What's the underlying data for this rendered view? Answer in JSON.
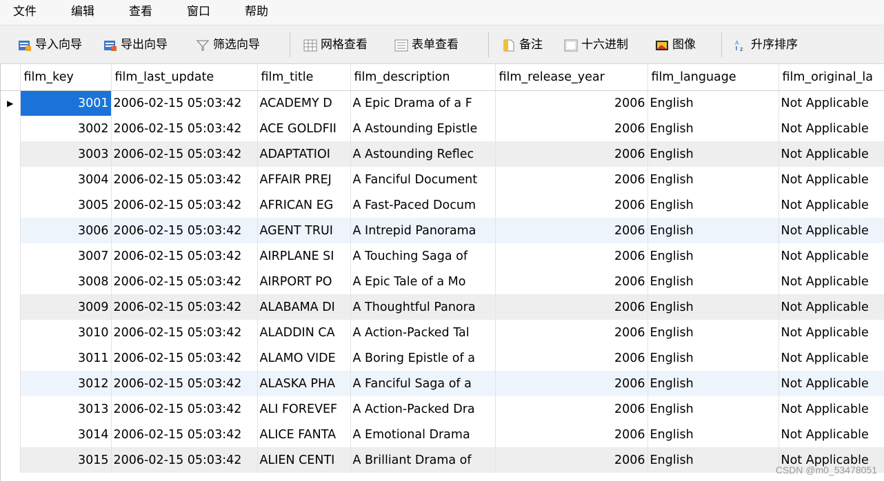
{
  "menu": [
    "文件",
    "编辑",
    "查看",
    "窗口",
    "帮助"
  ],
  "toolbar": {
    "import_label": "导入向导",
    "export_label": "导出向导",
    "filter_label": "筛选向导",
    "grid_view_label": "网格查看",
    "form_view_label": "表单查看",
    "memo_label": "备注",
    "hex_label": "十六进制",
    "image_label": "图像",
    "sort_asc_label": "升序排序"
  },
  "grid": {
    "columns": [
      "film_key",
      "film_last_update",
      "film_title",
      "film_description",
      "film_release_year",
      "film_language",
      "film_original_la"
    ],
    "rows": [
      [
        "3001",
        "2006-02-15 05:03:42",
        "ACADEMY D",
        "A Epic Drama of a F",
        "2006",
        "English",
        "Not Applicable"
      ],
      [
        "3002",
        "2006-02-15 05:03:42",
        "ACE GOLDFII",
        "A Astounding Epistle",
        "2006",
        "English",
        "Not Applicable"
      ],
      [
        "3003",
        "2006-02-15 05:03:42",
        "ADAPTATIOI",
        "A Astounding Reflec",
        "2006",
        "English",
        "Not Applicable"
      ],
      [
        "3004",
        "2006-02-15 05:03:42",
        "AFFAIR PREJ",
        "A Fanciful Document",
        "2006",
        "English",
        "Not Applicable"
      ],
      [
        "3005",
        "2006-02-15 05:03:42",
        "AFRICAN EG",
        "A Fast-Paced Docum",
        "2006",
        "English",
        "Not Applicable"
      ],
      [
        "3006",
        "2006-02-15 05:03:42",
        "AGENT TRUI",
        "A Intrepid Panorama",
        "2006",
        "English",
        "Not Applicable"
      ],
      [
        "3007",
        "2006-02-15 05:03:42",
        "AIRPLANE SI",
        "A Touching Saga of",
        "2006",
        "English",
        "Not Applicable"
      ],
      [
        "3008",
        "2006-02-15 05:03:42",
        "AIRPORT PO",
        "A Epic Tale of a Mo",
        "2006",
        "English",
        "Not Applicable"
      ],
      [
        "3009",
        "2006-02-15 05:03:42",
        "ALABAMA DI",
        "A Thoughtful Panora",
        "2006",
        "English",
        "Not Applicable"
      ],
      [
        "3010",
        "2006-02-15 05:03:42",
        "ALADDIN CA",
        "A Action-Packed Tal",
        "2006",
        "English",
        "Not Applicable"
      ],
      [
        "3011",
        "2006-02-15 05:03:42",
        "ALAMO VIDE",
        "A Boring Epistle of a",
        "2006",
        "English",
        "Not Applicable"
      ],
      [
        "3012",
        "2006-02-15 05:03:42",
        "ALASKA PHA",
        "A Fanciful Saga of a",
        "2006",
        "English",
        "Not Applicable"
      ],
      [
        "3013",
        "2006-02-15 05:03:42",
        "ALI FOREVEF",
        "A Action-Packed Dra",
        "2006",
        "English",
        "Not Applicable"
      ],
      [
        "3014",
        "2006-02-15 05:03:42",
        "ALICE FANTA",
        "A Emotional Drama",
        "2006",
        "English",
        "Not Applicable"
      ],
      [
        "3015",
        "2006-02-15 05:03:42",
        "ALIEN CENTI",
        "A Brilliant Drama of",
        "2006",
        "English",
        "Not Applicable"
      ]
    ],
    "row_styles": [
      "",
      "",
      "stripe",
      "",
      "",
      "blue",
      "",
      "",
      "stripe",
      "",
      "",
      "blue",
      "",
      "",
      "stripe"
    ],
    "selected_row": 0
  },
  "watermark": "CSDN @m0_53478051",
  "colors": {
    "selection": "#1a73d8",
    "stripe": "#eeeeee",
    "highlight_row": "#eef4fb"
  },
  "icons": [
    "import-icon",
    "export-icon",
    "filter-icon",
    "grid-icon",
    "form-icon",
    "memo-icon",
    "hex-icon",
    "image-icon",
    "sort-asc-icon",
    "row-pointer-icon"
  ]
}
